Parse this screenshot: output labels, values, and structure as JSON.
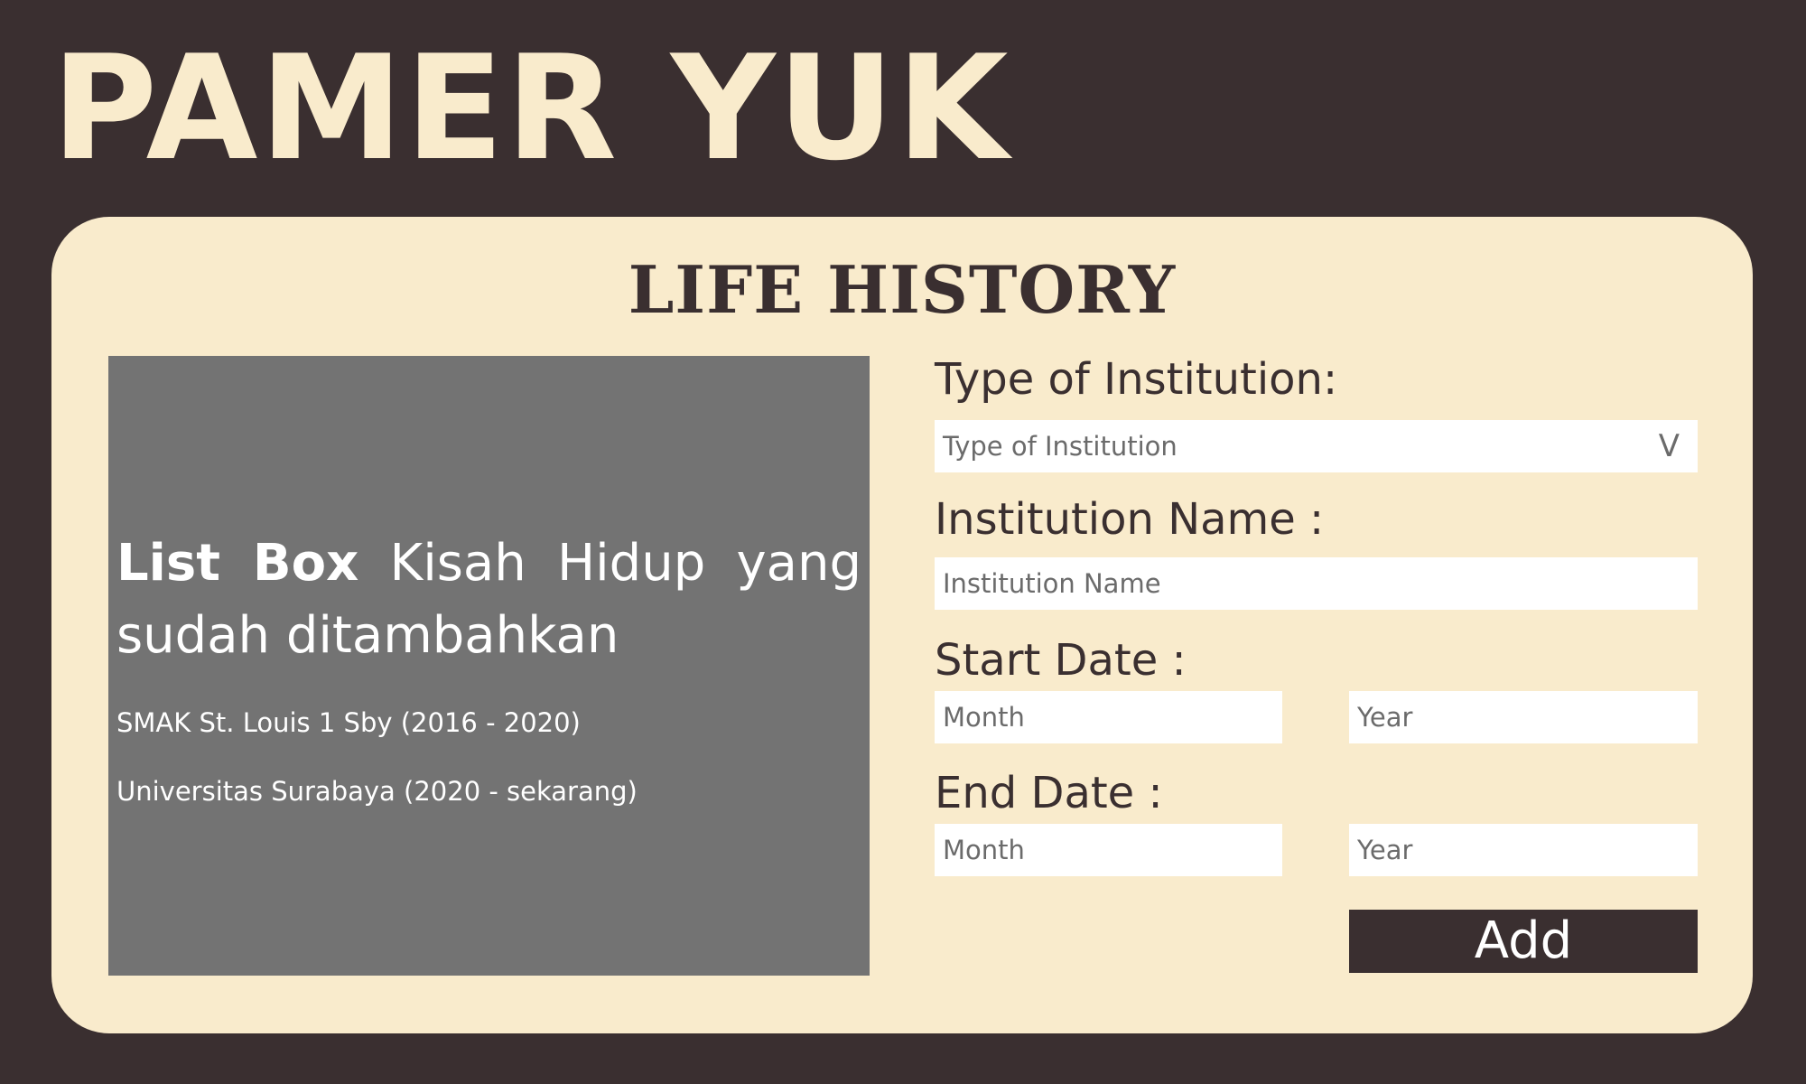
{
  "brand": "PAMER YUK",
  "card": {
    "title": "LIFE HISTORY"
  },
  "listbox": {
    "heading_bold": "List Box",
    "heading_rest": " Kisah Hidup yang sudah ditambahkan",
    "items": [
      "SMAK St. Louis 1 Sby (2016 - 2020)",
      "Universitas Surabaya (2020 - sekarang)"
    ]
  },
  "form": {
    "type_label": "Type of Institution:",
    "type_placeholder": "Type of Institution",
    "type_chevron": "V",
    "name_label": "Institution Name :",
    "name_placeholder": "Institution Name",
    "start_label": "Start Date :",
    "start_month_placeholder": "Month",
    "start_year_placeholder": "Year",
    "end_label": "End Date :",
    "end_month_placeholder": "Month",
    "end_year_placeholder": "Year",
    "add_label": "Add"
  },
  "colors": {
    "background": "#3a2f30",
    "card": "#f9ebcc",
    "listbox": "#737373",
    "button": "#3a2f30"
  }
}
